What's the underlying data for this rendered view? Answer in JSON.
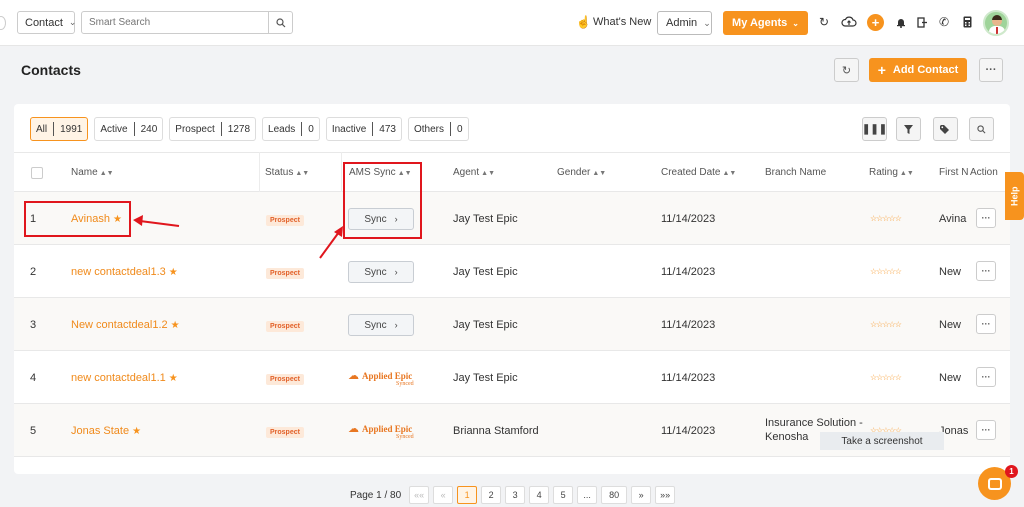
{
  "topbar": {
    "entity_select": "Contact",
    "search_placeholder": "Smart Search",
    "whats_new": "What's New",
    "admin_select": "Admin",
    "my_agents": "My Agents"
  },
  "page": {
    "title": "Contacts",
    "add_contact": "Add Contact"
  },
  "filters": [
    {
      "label": "All",
      "count": "1991"
    },
    {
      "label": "Active",
      "count": "240"
    },
    {
      "label": "Prospect",
      "count": "1278"
    },
    {
      "label": "Leads",
      "count": "0"
    },
    {
      "label": "Inactive",
      "count": "473"
    },
    {
      "label": "Others",
      "count": "0"
    }
  ],
  "columns": {
    "name": "Name",
    "status": "Status",
    "ams_sync": "AMS Sync",
    "agent": "Agent",
    "gender": "Gender",
    "created_date": "Created Date",
    "branch_name": "Branch Name",
    "rating": "Rating",
    "first_name": "First N",
    "action": "Action"
  },
  "rows": [
    {
      "num": "1",
      "name": "Avinash",
      "status": "Prospect",
      "sync": "Sync",
      "agent": "Jay Test Epic",
      "created": "11/14/2023",
      "branch": "",
      "rating": "☆☆☆☆☆",
      "first": "Avina"
    },
    {
      "num": "2",
      "name": "new contactdeal1.3",
      "status": "Prospect",
      "sync": "Sync",
      "agent": "Jay Test Epic",
      "created": "11/14/2023",
      "branch": "",
      "rating": "☆☆☆☆☆",
      "first": "New"
    },
    {
      "num": "3",
      "name": "New contactdeal1.2",
      "status": "Prospect",
      "sync": "Sync",
      "agent": "Jay Test Epic",
      "created": "11/14/2023",
      "branch": "",
      "rating": "☆☆☆☆☆",
      "first": "New"
    },
    {
      "num": "4",
      "name": "new contactdeal1.1",
      "status": "Prospect",
      "sync_logo": "Applied Epic",
      "sync_logo_sub": "Synced",
      "agent": "Jay Test Epic",
      "created": "11/14/2023",
      "branch": "",
      "rating": "☆☆☆☆☆",
      "first": "New"
    },
    {
      "num": "5",
      "name": "Jonas State",
      "status": "Prospect",
      "sync_logo": "Applied Epic",
      "sync_logo_sub": "Synced",
      "agent": "Brianna Stamford",
      "created": "11/14/2023",
      "branch": "Insurance Solution - Kenosha",
      "rating": "☆☆☆☆☆",
      "first": "Jonas"
    }
  ],
  "overlay": {
    "screenshot_tip": "Take a screenshot"
  },
  "pagination": {
    "label": "Page 1 / 80",
    "first": "««",
    "prev": "«",
    "pages": [
      "1",
      "2",
      "3",
      "4",
      "5",
      "...",
      "80"
    ],
    "next": "»",
    "last": "»»"
  },
  "help_label": "Help",
  "chat_badge": "1",
  "colors": {
    "accent": "#f7931e",
    "annotation": "#e0161d"
  }
}
